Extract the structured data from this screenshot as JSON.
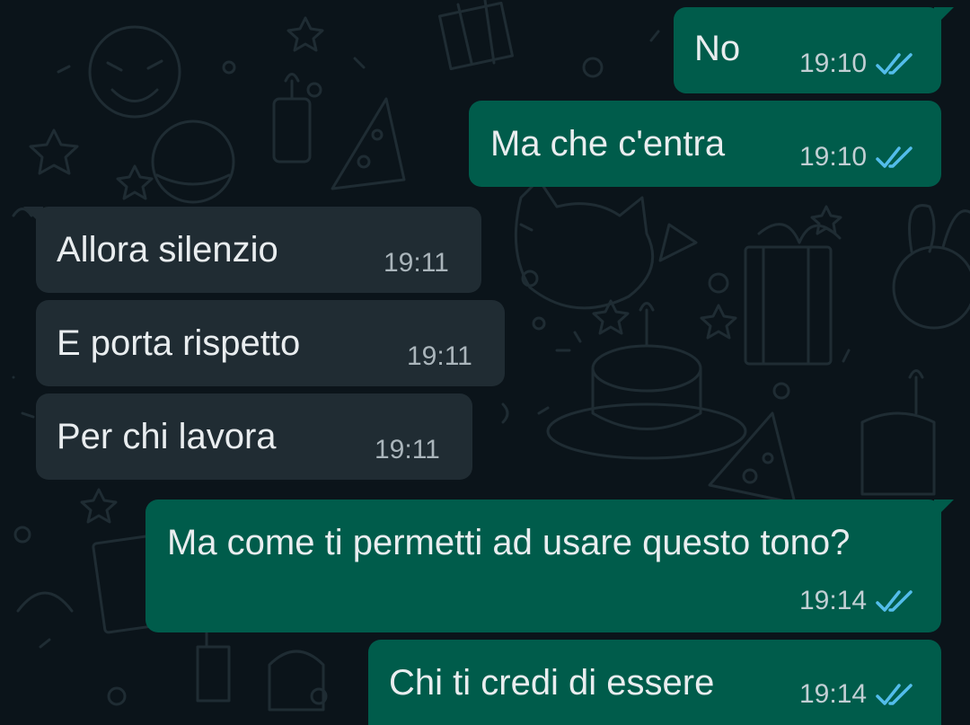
{
  "colors": {
    "background": "#0b141a",
    "outgoing_bubble": "#005c4b",
    "incoming_bubble": "#202c33",
    "read_ticks": "#53bdeb",
    "text": "#e9edef"
  },
  "messages": [
    {
      "direction": "outgoing",
      "text": "No",
      "time": "19:10",
      "status": "read-double-check-icon"
    },
    {
      "direction": "outgoing",
      "text": "Ma che c'entra",
      "time": "19:10",
      "status": "read-double-check-icon"
    },
    {
      "direction": "incoming",
      "text": "Allora silenzio",
      "time": "19:11"
    },
    {
      "direction": "incoming",
      "text": "E porta rispetto",
      "time": "19:11"
    },
    {
      "direction": "incoming",
      "text": "Per chi lavora",
      "time": "19:11"
    },
    {
      "direction": "outgoing",
      "text": "Ma come ti permetti ad usare questo tono?",
      "time": "19:14",
      "status": "read-double-check-icon"
    },
    {
      "direction": "outgoing",
      "text": "Chi ti credi di essere",
      "time": "19:14",
      "status": "read-double-check-icon"
    }
  ]
}
